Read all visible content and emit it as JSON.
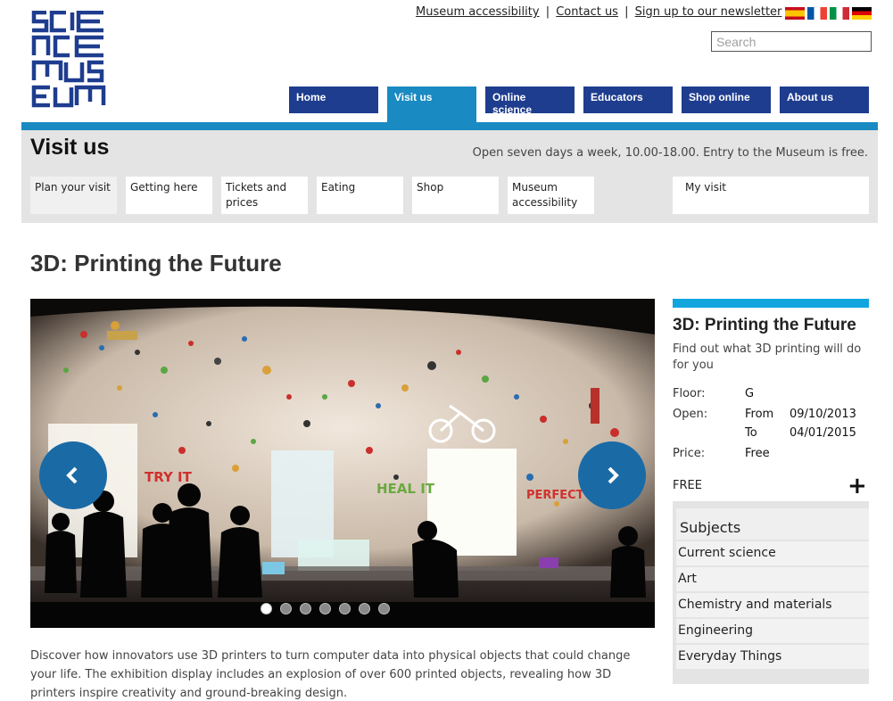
{
  "logo": {
    "text": "SCIENCE MUSEUM",
    "icon": "science-museum-logo"
  },
  "utility": {
    "accessibility": "Museum accessibility",
    "contact": "Contact us",
    "newsletter": "Sign up to our newsletter",
    "separator": "|"
  },
  "languages": [
    {
      "code": "es",
      "icon": "spain-flag-icon"
    },
    {
      "code": "fr",
      "icon": "france-flag-icon"
    },
    {
      "code": "it",
      "icon": "italy-flag-icon"
    },
    {
      "code": "de",
      "icon": "germany-flag-icon"
    }
  ],
  "search": {
    "placeholder": "Search"
  },
  "nav": {
    "tabs": [
      {
        "label": "Home"
      },
      {
        "label": "Visit us",
        "active": true
      },
      {
        "label": "Online science"
      },
      {
        "label": "Educators"
      },
      {
        "label": "Shop online"
      },
      {
        "label": "About us"
      }
    ]
  },
  "section": {
    "title": "Visit us",
    "note": "Open seven days a week, 10.00-18.00. Entry to the Museum is free."
  },
  "subnav": {
    "tabs": [
      {
        "label": "Plan your visit",
        "active": true
      },
      {
        "label": "Getting here"
      },
      {
        "label": "Tickets and prices"
      },
      {
        "label": "Eating"
      },
      {
        "label": "Shop"
      },
      {
        "label": "Museum accessibility"
      }
    ],
    "my_visit": "My visit"
  },
  "page": {
    "title": "3D: Printing the Future",
    "description": "Discover how innovators use 3D printers to turn computer data into physical objects that could change your life. The exhibition display includes an explosion of over 600 printed objects, revealing how 3D printers inspire creativity and ground-breaking design."
  },
  "carousel": {
    "wall_texts": [
      "TRY IT",
      "HEAL IT",
      "PERFECT IT"
    ],
    "slide_count": 7,
    "active_slide": 1,
    "prev_icon": "chevron-left-icon",
    "next_icon": "chevron-right-icon"
  },
  "sidebar": {
    "title": "3D: Printing the Future",
    "subtitle": "Find out what 3D printing will do for you",
    "floor_label": "Floor:",
    "floor_value": "G",
    "open_label": "Open:",
    "open_from": "From",
    "open_from_date": "09/10/2013",
    "open_to": "To",
    "open_to_date": "04/01/2015",
    "price_label": "Price:",
    "price_value": "Free",
    "free_label": "FREE",
    "expand_icon": "plus-icon",
    "subjects_heading": "Subjects",
    "subjects": [
      "Current science",
      "Art",
      "Chemistry and materials",
      "Engineering",
      "Everyday Things"
    ]
  },
  "colors": {
    "nav_blue": "#1e3d8f",
    "accent_blue": "#1a8ac2",
    "info_bar": "#12a6df",
    "band_grey": "#e4e4e4"
  }
}
